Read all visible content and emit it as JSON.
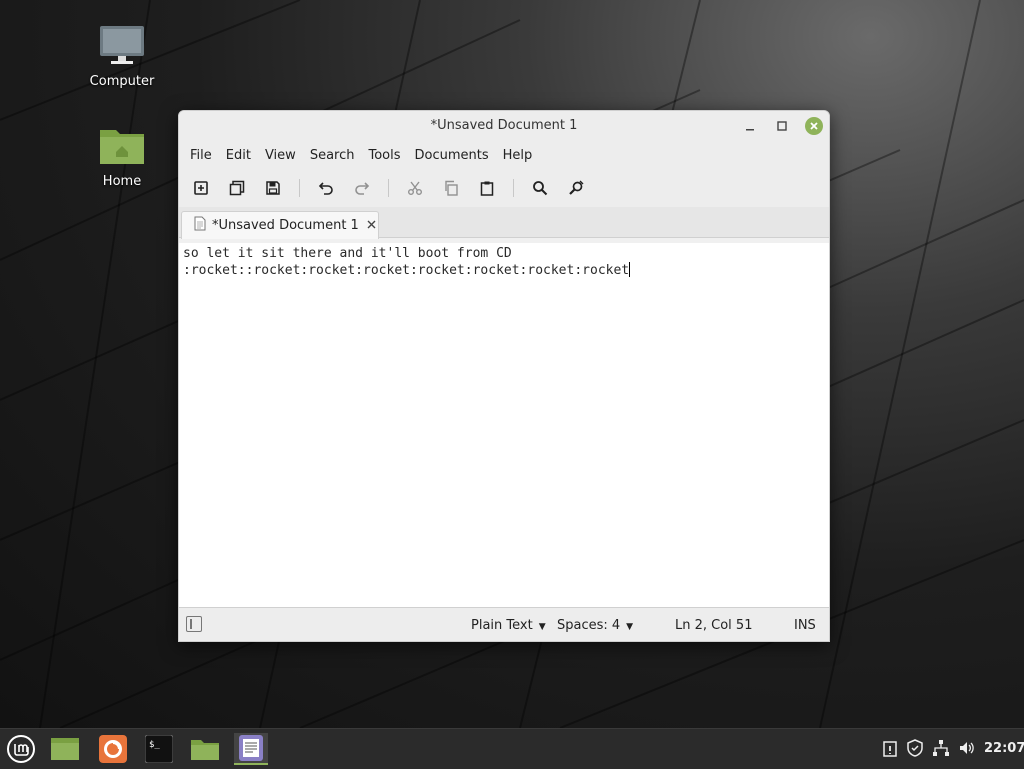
{
  "desktop": {
    "icons": [
      {
        "label": "Computer",
        "icon": "monitor-icon"
      },
      {
        "label": "Home",
        "icon": "folder-icon"
      }
    ]
  },
  "window": {
    "title": "*Unsaved Document 1",
    "menu": [
      "File",
      "Edit",
      "View",
      "Search",
      "Tools",
      "Documents",
      "Help"
    ],
    "toolbar": [
      "new-document-icon",
      "open-icon",
      "save-icon",
      "undo-icon",
      "redo-icon",
      "cut-icon",
      "copy-icon",
      "paste-icon",
      "search-icon",
      "replace-icon"
    ],
    "tab": {
      "label": "*Unsaved Document 1"
    },
    "editor": {
      "lines": [
        "so let it sit there and it'll boot from CD",
        ":rocket::rocket:rocket:rocket:rocket:rocket:rocket:rocket"
      ]
    },
    "status": {
      "language": "Plain Text",
      "indent": "Spaces: 4",
      "position": "Ln 2, Col 51",
      "mode": "INS"
    }
  },
  "taskbar": {
    "clock": "22:07",
    "accent": "#8fb35a"
  }
}
